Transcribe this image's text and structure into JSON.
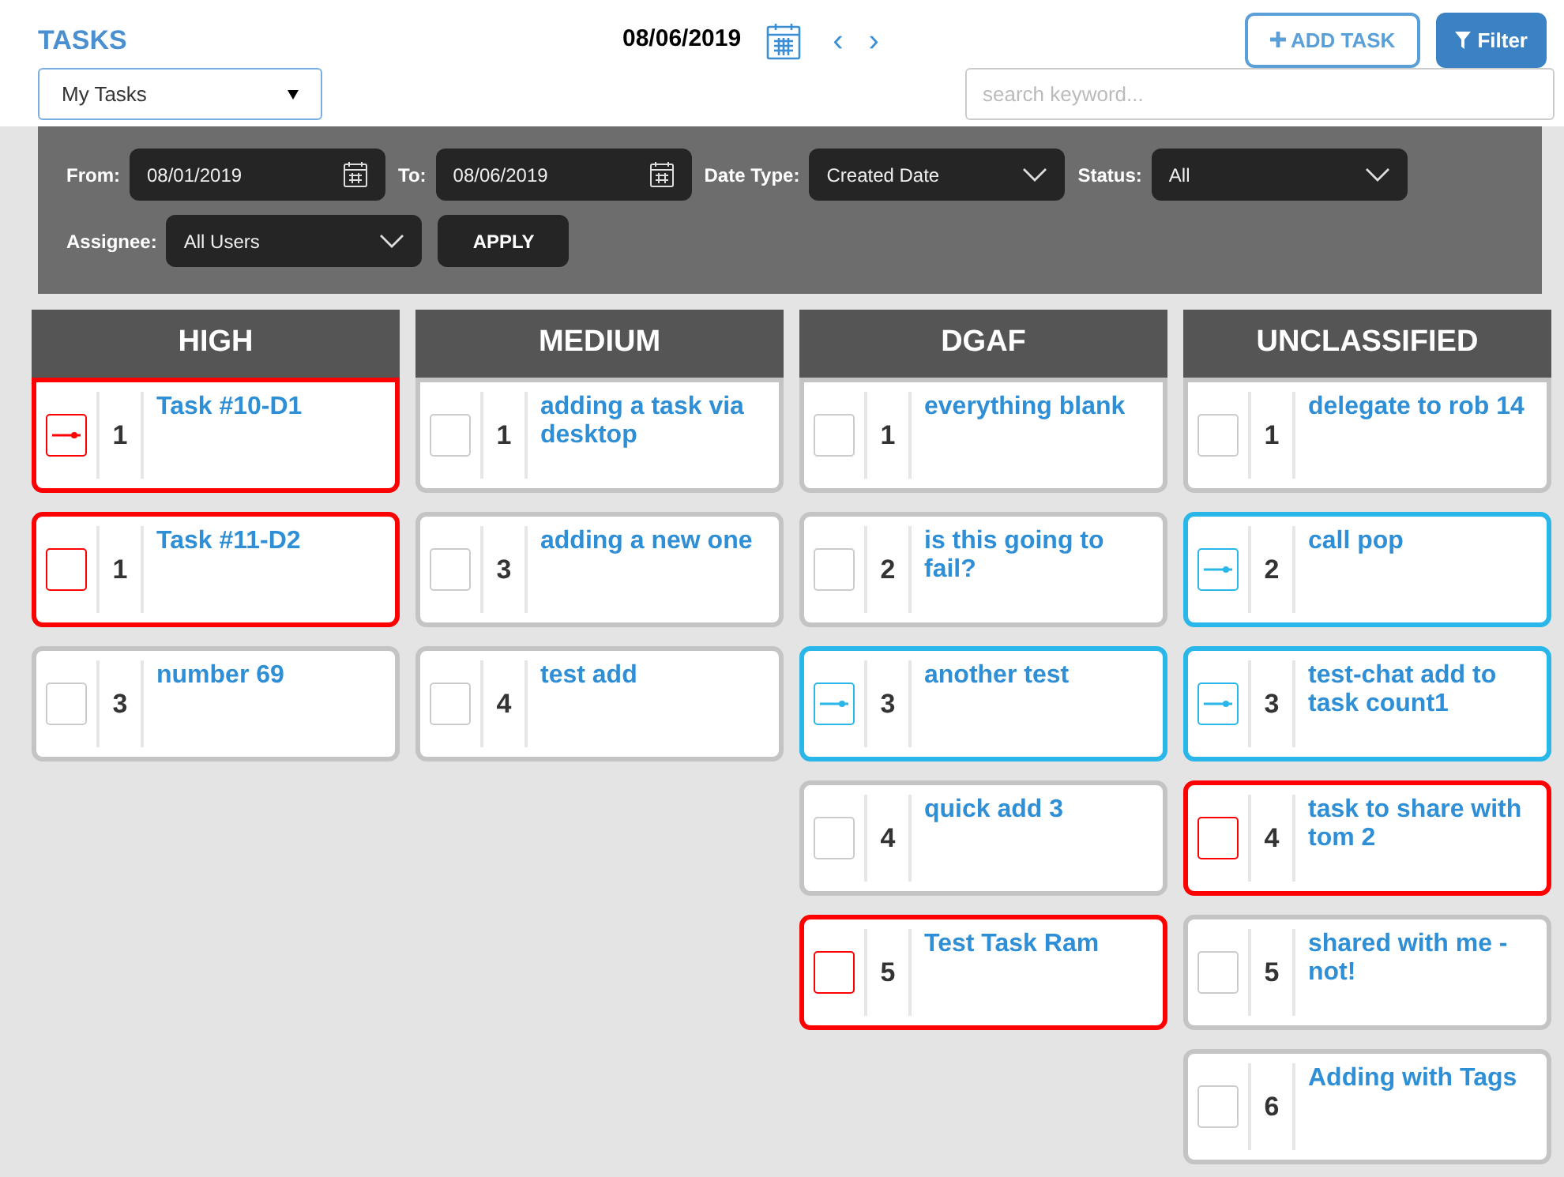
{
  "header": {
    "title": "TASKS",
    "date": "08/06/2019",
    "prev": "‹",
    "next": "›",
    "add_task": "ADD TASK",
    "filter": "Filter"
  },
  "view_select": {
    "value": "My Tasks"
  },
  "search": {
    "placeholder": "search keyword..."
  },
  "filters": {
    "from_label": "From:",
    "from": "08/01/2019",
    "to_label": "To:",
    "to": "08/06/2019",
    "date_type_label": "Date Type:",
    "date_type": "Created Date",
    "status_label": "Status:",
    "status": "All",
    "assignee_label": "Assignee:",
    "assignee": "All Users",
    "apply": "APPLY"
  },
  "columns": [
    {
      "title": "HIGH",
      "tasks": [
        {
          "number": "1",
          "title": "Task #10-D1",
          "color": "#ff0000",
          "started": true
        },
        {
          "number": "1",
          "title": "Task #11-D2",
          "color": "#ff0000",
          "started": false
        },
        {
          "number": "3",
          "title": "number 69",
          "color": "#c4c4c4",
          "started": false
        }
      ]
    },
    {
      "title": "MEDIUM",
      "tasks": [
        {
          "number": "1",
          "title": "adding a task via desktop",
          "color": "#c4c4c4",
          "started": false
        },
        {
          "number": "3",
          "title": "adding a new one",
          "color": "#c4c4c4",
          "started": false
        },
        {
          "number": "4",
          "title": "test add",
          "color": "#c4c4c4",
          "started": false
        }
      ]
    },
    {
      "title": "DGAF",
      "tasks": [
        {
          "number": "1",
          "title": "everything blank",
          "color": "#c4c4c4",
          "started": false
        },
        {
          "number": "2",
          "title": "is this going to fail?",
          "color": "#c4c4c4",
          "started": false
        },
        {
          "number": "3",
          "title": "another test",
          "color": "#29b6e8",
          "started": true
        },
        {
          "number": "4",
          "title": "quick add 3",
          "color": "#c4c4c4",
          "started": false
        },
        {
          "number": "5",
          "title": "Test Task Ram",
          "color": "#ff0000",
          "started": false
        }
      ]
    },
    {
      "title": "UNCLASSIFIED",
      "tasks": [
        {
          "number": "1",
          "title": "delegate to rob 14",
          "color": "#c4c4c4",
          "started": false
        },
        {
          "number": "2",
          "title": "call pop",
          "color": "#29b6e8",
          "started": true
        },
        {
          "number": "3",
          "title": "test-chat add to task count1",
          "color": "#29b6e8",
          "started": true
        },
        {
          "number": "4",
          "title": "task to share with tom 2",
          "color": "#ff0000",
          "started": false
        },
        {
          "number": "5",
          "title": "shared with me - not!",
          "color": "#c4c4c4",
          "started": false
        },
        {
          "number": "6",
          "title": "Adding with Tags",
          "color": "#c4c4c4",
          "started": false
        }
      ]
    }
  ]
}
